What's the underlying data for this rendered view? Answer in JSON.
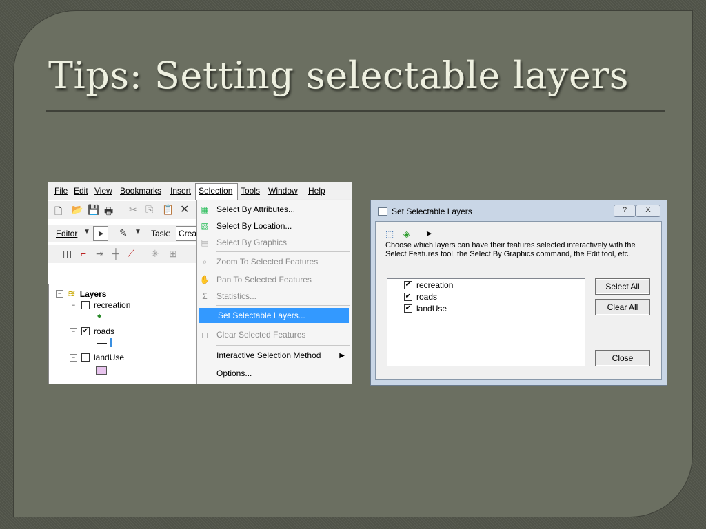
{
  "slide": {
    "title": "Tips: Setting selectable layers"
  },
  "arcmap": {
    "menubar": [
      "File",
      "Edit",
      "View",
      "Bookmarks",
      "Insert",
      "Selection",
      "Tools",
      "Window",
      "Help"
    ],
    "editor_label": "Editor",
    "task_label": "Task:",
    "task_value": "Crea",
    "toc": {
      "root": "Layers",
      "layers": [
        {
          "name": "recreation",
          "checked": false
        },
        {
          "name": "roads",
          "checked": true
        },
        {
          "name": "landUse",
          "checked": false
        }
      ]
    },
    "selection_menu": [
      {
        "label": "Select By Attributes...",
        "enabled": true
      },
      {
        "label": "Select By Location...",
        "enabled": true
      },
      {
        "label": "Select By Graphics",
        "enabled": false
      },
      {
        "label": "Zoom To Selected Features",
        "enabled": false
      },
      {
        "label": "Pan To Selected Features",
        "enabled": false
      },
      {
        "label": "Statistics...",
        "enabled": false
      },
      {
        "label": "Set Selectable Layers...",
        "enabled": true,
        "highlighted": true
      },
      {
        "label": "Clear Selected Features",
        "enabled": false
      },
      {
        "label": "Interactive Selection Method",
        "enabled": true
      },
      {
        "label": "Options...",
        "enabled": true
      }
    ]
  },
  "dialog": {
    "title": "Set Selectable Layers",
    "help_button": "?",
    "close_x": "X",
    "description": "Choose which layers can have their features selected interactively with the Select Features tool, the Select By Graphics command, the Edit tool, etc.",
    "layers": [
      {
        "name": "recreation",
        "checked": true
      },
      {
        "name": "roads",
        "checked": true
      },
      {
        "name": "landUse",
        "checked": true
      }
    ],
    "buttons": {
      "select_all": "Select All",
      "clear_all": "Clear All",
      "close": "Close"
    }
  },
  "colors": {
    "menu_highlight": "#3399ff",
    "slide_bg": "#6b6f61",
    "title": "#eef0e0"
  }
}
